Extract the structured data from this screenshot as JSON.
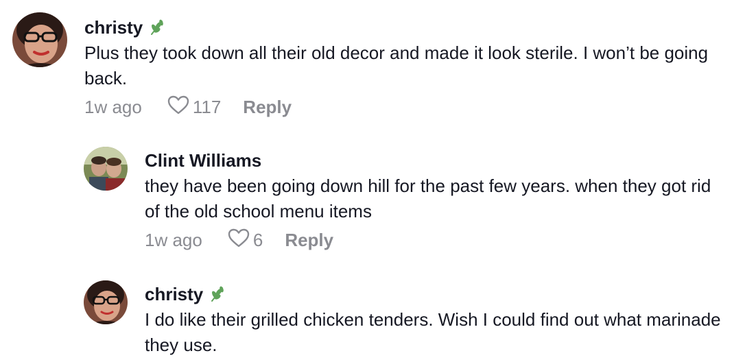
{
  "comments": [
    {
      "author": "christy",
      "text": "Plus they took down all their old decor and made it look sterile. I won’t be going back.",
      "time": "1w ago",
      "likes": "117",
      "reply_label": "Reply",
      "badge_icon": "leaf-icon"
    },
    {
      "author": "Clint Williams",
      "text": "they have been going down hill for the past few years. when they got rid of the old school menu items",
      "time": "1w ago",
      "likes": "6",
      "reply_label": "Reply"
    },
    {
      "author": "christy",
      "text": "I do like their grilled chicken tenders. Wish I could find out what marinade they use.",
      "badge_icon": "leaf-icon"
    }
  ],
  "colors": {
    "text": "#161823",
    "muted": "#8a8b91",
    "leaf": "#5fa35a"
  }
}
